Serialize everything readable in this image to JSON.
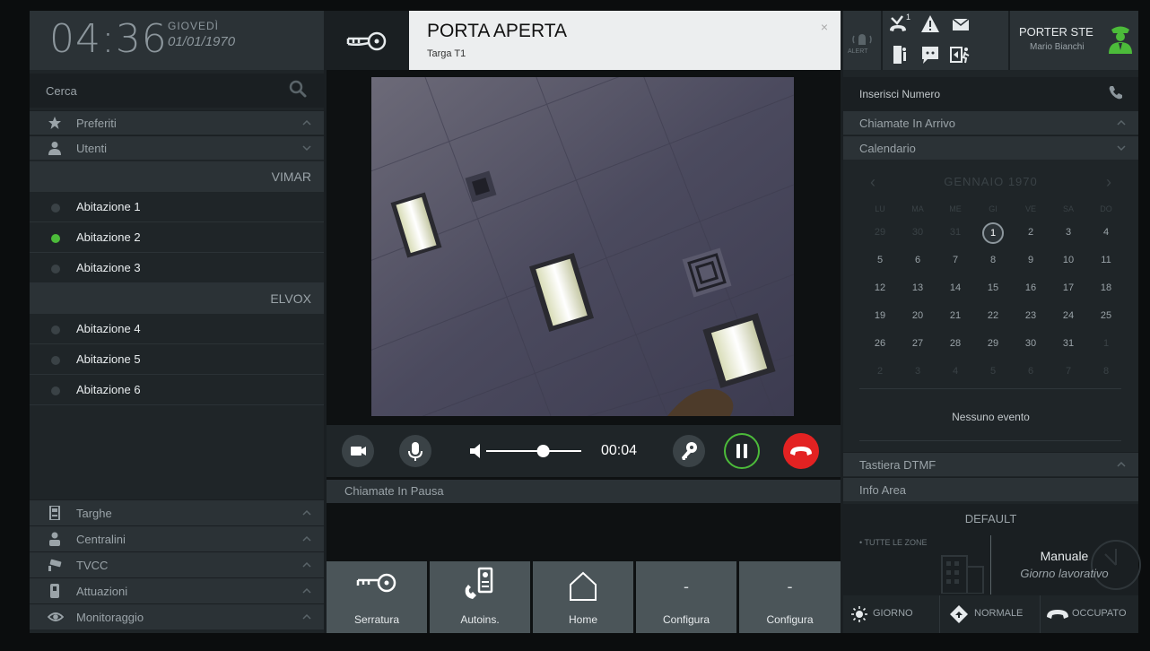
{
  "clock": {
    "time": "04:36",
    "day": "GIOVEDÌ",
    "date": "01/01/1970"
  },
  "search": {
    "placeholder": "Cerca"
  },
  "left_sections": {
    "favorites": "Preferiti",
    "users": "Utenti"
  },
  "groups": [
    {
      "name": "VIMAR",
      "users": [
        {
          "label": "Abitazione 1",
          "online": false
        },
        {
          "label": "Abitazione 2",
          "online": true
        },
        {
          "label": "Abitazione 3",
          "online": false
        }
      ]
    },
    {
      "name": "ELVOX",
      "users": [
        {
          "label": "Abitazione 4",
          "online": false
        },
        {
          "label": "Abitazione 5",
          "online": false
        },
        {
          "label": "Abitazione 6",
          "online": false
        }
      ]
    }
  ],
  "bottom_sections": [
    "Targhe",
    "Centralini",
    "TVCC",
    "Attuazioni",
    "Monitoraggio"
  ],
  "notification": {
    "title": "PORTA APERTA",
    "subtitle": "Targa T1",
    "close": "×"
  },
  "call": {
    "timer": "00:04",
    "volume": 0.6
  },
  "paused_calls": {
    "label": "Chiamate In Pausa"
  },
  "tiles": [
    {
      "label": "Serratura",
      "icon": "key-lock-icon"
    },
    {
      "label": "Autoins.",
      "icon": "intercom-icon"
    },
    {
      "label": "Home",
      "icon": "home-icon"
    },
    {
      "label": "Configura",
      "icon": "dash",
      "value": "-"
    },
    {
      "label": "Configura",
      "icon": "dash",
      "value": "-"
    }
  ],
  "topbar": {
    "alert": "ALERT",
    "missed_count": "1",
    "porter_title": "PORTER STE",
    "porter_name": "Mario Bianchi"
  },
  "dial": {
    "placeholder": "Inserisci Numero"
  },
  "right_sections": {
    "incoming": "Chiamate In Arrivo",
    "calendar": "Calendario",
    "dtmf": "Tastiera DTMF",
    "info": "Info Area"
  },
  "calendar": {
    "month": "GENNAIO",
    "year": "1970",
    "weekdays": [
      "LU",
      "MA",
      "ME",
      "GI",
      "VE",
      "SA",
      "DO"
    ],
    "weeks": [
      [
        "29",
        "30",
        "31",
        "1",
        "2",
        "3",
        "4"
      ],
      [
        "5",
        "6",
        "7",
        "8",
        "9",
        "10",
        "11"
      ],
      [
        "12",
        "13",
        "14",
        "15",
        "16",
        "17",
        "18"
      ],
      [
        "19",
        "20",
        "21",
        "22",
        "23",
        "24",
        "25"
      ],
      [
        "26",
        "27",
        "28",
        "29",
        "30",
        "31",
        "1"
      ],
      [
        "2",
        "3",
        "4",
        "5",
        "6",
        "7",
        "8"
      ]
    ],
    "today": "1",
    "no_event": "Nessuno evento"
  },
  "info_area": {
    "profile": "DEFAULT",
    "zone": "• TUTTE LE ZONE",
    "mode": "Manuale",
    "day_type": "Giorno lavorativo"
  },
  "modes": {
    "day": "GIORNO",
    "normal": "NORMALE",
    "busy": "OCCUPATO"
  },
  "colors": {
    "accent_green": "#4cbb3a",
    "hangup_red": "#e32222",
    "background": "#1a1f22"
  }
}
